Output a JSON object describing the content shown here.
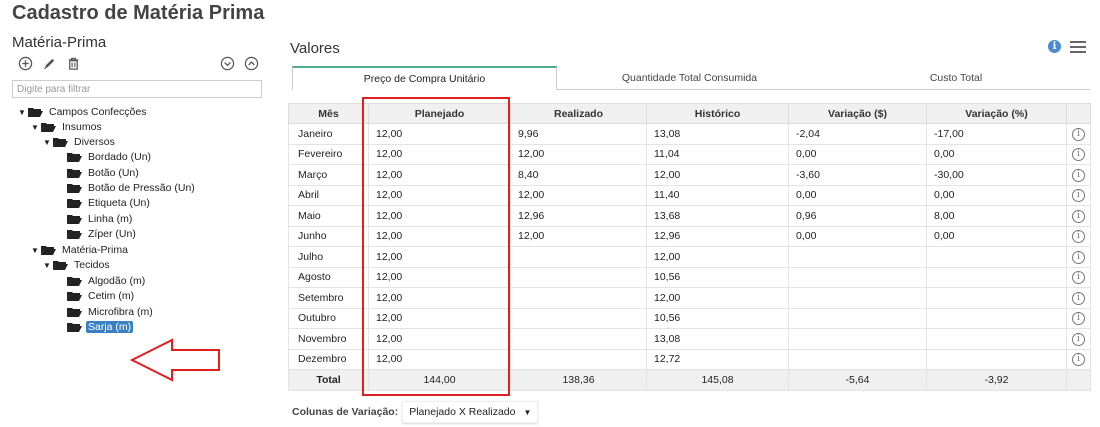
{
  "page": {
    "title": "Cadastro de Matéria Prima"
  },
  "left": {
    "heading": "Matéria-Prima",
    "toolbar": {
      "add_icon": "add-circle-icon",
      "edit_icon": "pencil-icon",
      "delete_icon": "trash-icon",
      "expand_icon": "chevron-down-circle-icon",
      "collapse_icon": "chevron-up-circle-icon"
    },
    "filter_placeholder": "Digite para filtrar",
    "tree": [
      {
        "label": "Campos Confecções"
      },
      {
        "label": "Insumos"
      },
      {
        "label": "Diversos"
      },
      {
        "label": "Bordado (Un)"
      },
      {
        "label": "Botão (Un)"
      },
      {
        "label": "Botão de Pressão (Un)"
      },
      {
        "label": "Etiqueta (Un)"
      },
      {
        "label": "Linha (m)"
      },
      {
        "label": "Zíper (Un)"
      },
      {
        "label": "Matéria-Prima"
      },
      {
        "label": "Tecidos"
      },
      {
        "label": "Algodão (m)"
      },
      {
        "label": "Cetim (m)"
      },
      {
        "label": "Microfibra (m)"
      },
      {
        "label": "Sarja (m)"
      }
    ]
  },
  "right": {
    "title": "Valores",
    "tabs": [
      {
        "label": "Preço de Compra Unitário"
      },
      {
        "label": "Quantidade Total Consumida"
      },
      {
        "label": "Custo Total"
      }
    ],
    "table": {
      "headers": [
        "Mês",
        "Planejado",
        "Realizado",
        "Histórico",
        "Variação ($)",
        "Variação (%)"
      ],
      "rows": [
        {
          "month": "Janeiro",
          "planejado": "12,00",
          "realizado": "9,96",
          "historico": "13,08",
          "var_abs": "-2,04",
          "var_pct": "-17,00",
          "sign": "neg"
        },
        {
          "month": "Fevereiro",
          "planejado": "12,00",
          "realizado": "12,00",
          "historico": "11,04",
          "var_abs": "0,00",
          "var_pct": "0,00",
          "sign": "zero"
        },
        {
          "month": "Março",
          "planejado": "12,00",
          "realizado": "8,40",
          "historico": "12,00",
          "var_abs": "-3,60",
          "var_pct": "-30,00",
          "sign": "neg"
        },
        {
          "month": "Abril",
          "planejado": "12,00",
          "realizado": "12,00",
          "historico": "11,40",
          "var_abs": "0,00",
          "var_pct": "0,00",
          "sign": "zero"
        },
        {
          "month": "Maio",
          "planejado": "12,00",
          "realizado": "12,96",
          "historico": "13,68",
          "var_abs": "0,96",
          "var_pct": "8,00",
          "sign": "pos"
        },
        {
          "month": "Junho",
          "planejado": "12,00",
          "realizado": "12,00",
          "historico": "12,96",
          "var_abs": "0,00",
          "var_pct": "0,00",
          "sign": "zero"
        },
        {
          "month": "Julho",
          "planejado": "12,00",
          "realizado": "",
          "historico": "12,00",
          "var_abs": "",
          "var_pct": "",
          "sign": "zero"
        },
        {
          "month": "Agosto",
          "planejado": "12,00",
          "realizado": "",
          "historico": "10,56",
          "var_abs": "",
          "var_pct": "",
          "sign": "zero"
        },
        {
          "month": "Setembro",
          "planejado": "12,00",
          "realizado": "",
          "historico": "12,00",
          "var_abs": "",
          "var_pct": "",
          "sign": "zero"
        },
        {
          "month": "Outubro",
          "planejado": "12,00",
          "realizado": "",
          "historico": "10,56",
          "var_abs": "",
          "var_pct": "",
          "sign": "zero"
        },
        {
          "month": "Novembro",
          "planejado": "12,00",
          "realizado": "",
          "historico": "13,08",
          "var_abs": "",
          "var_pct": "",
          "sign": "zero"
        },
        {
          "month": "Dezembro",
          "planejado": "12,00",
          "realizado": "",
          "historico": "12,72",
          "var_abs": "",
          "var_pct": "",
          "sign": "zero"
        }
      ],
      "total": {
        "label": "Total",
        "planejado": "144,00",
        "realizado": "138,36",
        "historico": "145,08",
        "var_abs": "-5,64",
        "var_pct": "-3,92"
      },
      "row_info_icon": "info-circle-icon"
    },
    "variation": {
      "label": "Colunas de Variação:",
      "selected": "Planejado X Realizado"
    }
  },
  "colors": {
    "negative": "#2e8b2e",
    "positive": "#d8202a",
    "tab_accent": "#4cae8e",
    "selection": "#3a7fc1",
    "annotation": "#e02020"
  }
}
